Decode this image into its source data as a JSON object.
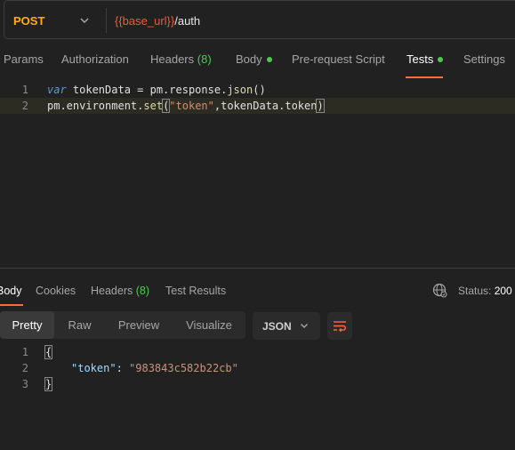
{
  "request": {
    "method": "POST",
    "url_variable": "{{base_url}}",
    "url_path": "/auth"
  },
  "request_tabs": [
    {
      "label": "Params"
    },
    {
      "label": "Authorization"
    },
    {
      "label": "Headers",
      "count": "(8)"
    },
    {
      "label": "Body",
      "dot": true
    },
    {
      "label": "Pre-request Script"
    },
    {
      "label": "Tests",
      "dot": true,
      "active": true
    },
    {
      "label": "Settings"
    }
  ],
  "script_lines": [
    {
      "number": "1",
      "keyword": "var",
      "identifier": " tokenData = pm.response.",
      "method": "json",
      "rest": "()"
    },
    {
      "number": "2",
      "object": "pm.environment.",
      "method": "set",
      "open": "(",
      "string": "\"token\"",
      "args": ",tokenData.token",
      "close": ")"
    }
  ],
  "response_tabs": [
    {
      "label": "Body",
      "active": true
    },
    {
      "label": "Cookies"
    },
    {
      "label": "Headers",
      "count": "(8)"
    },
    {
      "label": "Test Results"
    }
  ],
  "status": {
    "label": "Status:",
    "value": "200"
  },
  "view_modes": [
    "Pretty",
    "Raw",
    "Preview",
    "Visualize"
  ],
  "format": "JSON",
  "response_lines": [
    {
      "number": "1",
      "text": "{"
    },
    {
      "number": "2",
      "key": "\"token\"",
      "sep": ": ",
      "value": "\"983843c582b22cb\""
    },
    {
      "number": "3",
      "text": "}"
    }
  ],
  "colors": {
    "accent": "#ff6c37",
    "success": "#4ec94e",
    "method_post": "#ffb000",
    "variable": "#f05b39"
  },
  "icons": [
    "chevron-down-icon",
    "globe-icon",
    "wrap-lines-icon"
  ]
}
